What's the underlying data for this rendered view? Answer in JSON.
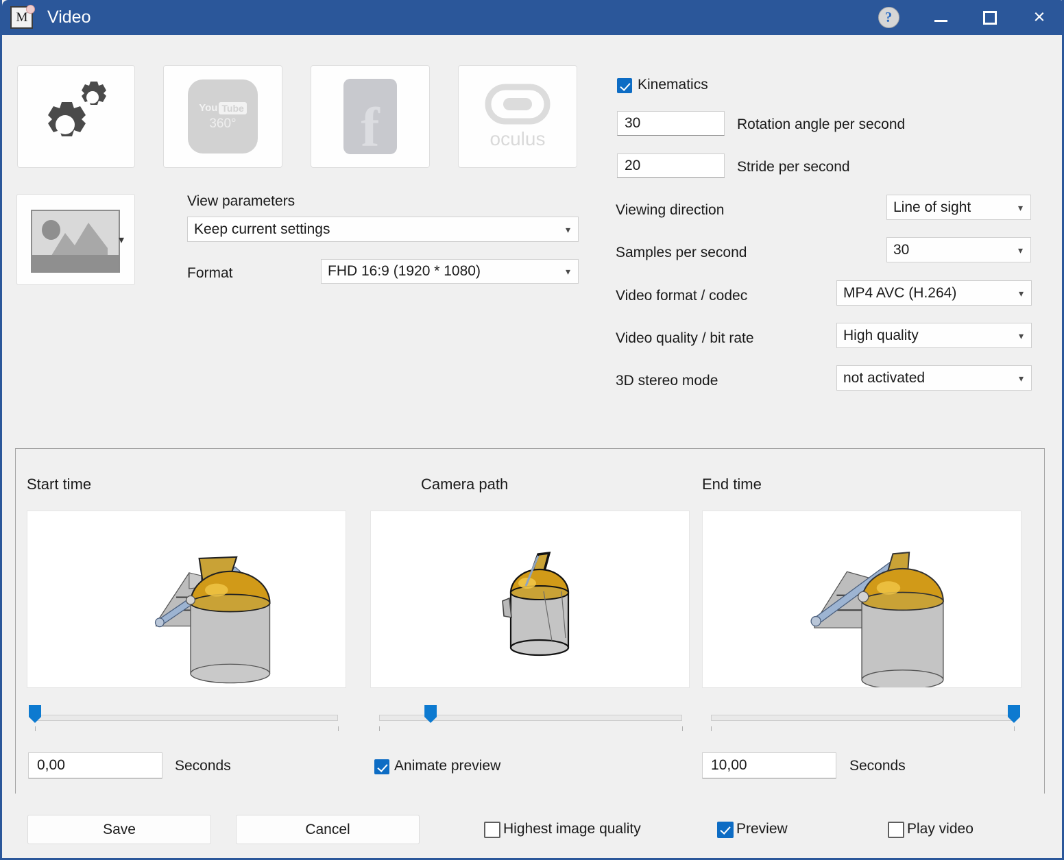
{
  "window": {
    "title": "Video",
    "app_icon": "M",
    "accent_color": "#2b579a",
    "help_glyph": "?",
    "minimize_name": "minimize",
    "maximize_name": "maximize",
    "close_glyph": "×"
  },
  "tiles": [
    {
      "name": "settings",
      "icon": "gears-icon",
      "label": ""
    },
    {
      "name": "youtube360",
      "icon": "youtube-360-icon",
      "label_top": "You",
      "label_tube": "Tube",
      "label_bottom": "360°"
    },
    {
      "name": "facebook",
      "icon": "facebook-icon",
      "label": "f"
    },
    {
      "name": "oculus",
      "icon": "oculus-icon",
      "label": "oculus"
    }
  ],
  "view": {
    "parameters_label": "View parameters",
    "parameters_value": "Keep current settings",
    "format_label": "Format",
    "format_value": "FHD 16:9 (1920 * 1080)",
    "thumbnail_icon": "image-landscape-icon"
  },
  "settings": {
    "kinematics_label": "Kinematics",
    "kinematics_checked": true,
    "rotation_value": "30",
    "rotation_label": "Rotation angle per second",
    "stride_value": "20",
    "stride_label": "Stride per second",
    "viewing_direction_label": "Viewing direction",
    "viewing_direction_value": "Line of sight",
    "samples_label": "Samples per second",
    "samples_value": "30",
    "codec_label": "Video format / codec",
    "codec_value": "MP4 AVC (H.264)",
    "bitrate_label": "Video quality / bit rate",
    "bitrate_value": "High quality",
    "stereo_label": "3D stereo mode",
    "stereo_value": "not activated"
  },
  "timeline": {
    "start_title": "Start time",
    "camera_title": "Camera path",
    "end_title": "End time",
    "start_seconds_value": "0,00",
    "start_seconds_label": "Seconds",
    "end_seconds_value": "10,00",
    "end_seconds_label": "Seconds",
    "animate_label": "Animate preview",
    "animate_checked": true,
    "start_slider_pct": 0,
    "camera_slider_pct": 17,
    "end_slider_pct": 100
  },
  "footer": {
    "save_label": "Save",
    "cancel_label": "Cancel",
    "highest_quality_label": "Highest image quality",
    "highest_quality_checked": false,
    "preview_label": "Preview",
    "preview_checked": true,
    "play_video_label": "Play video",
    "play_video_checked": false
  }
}
